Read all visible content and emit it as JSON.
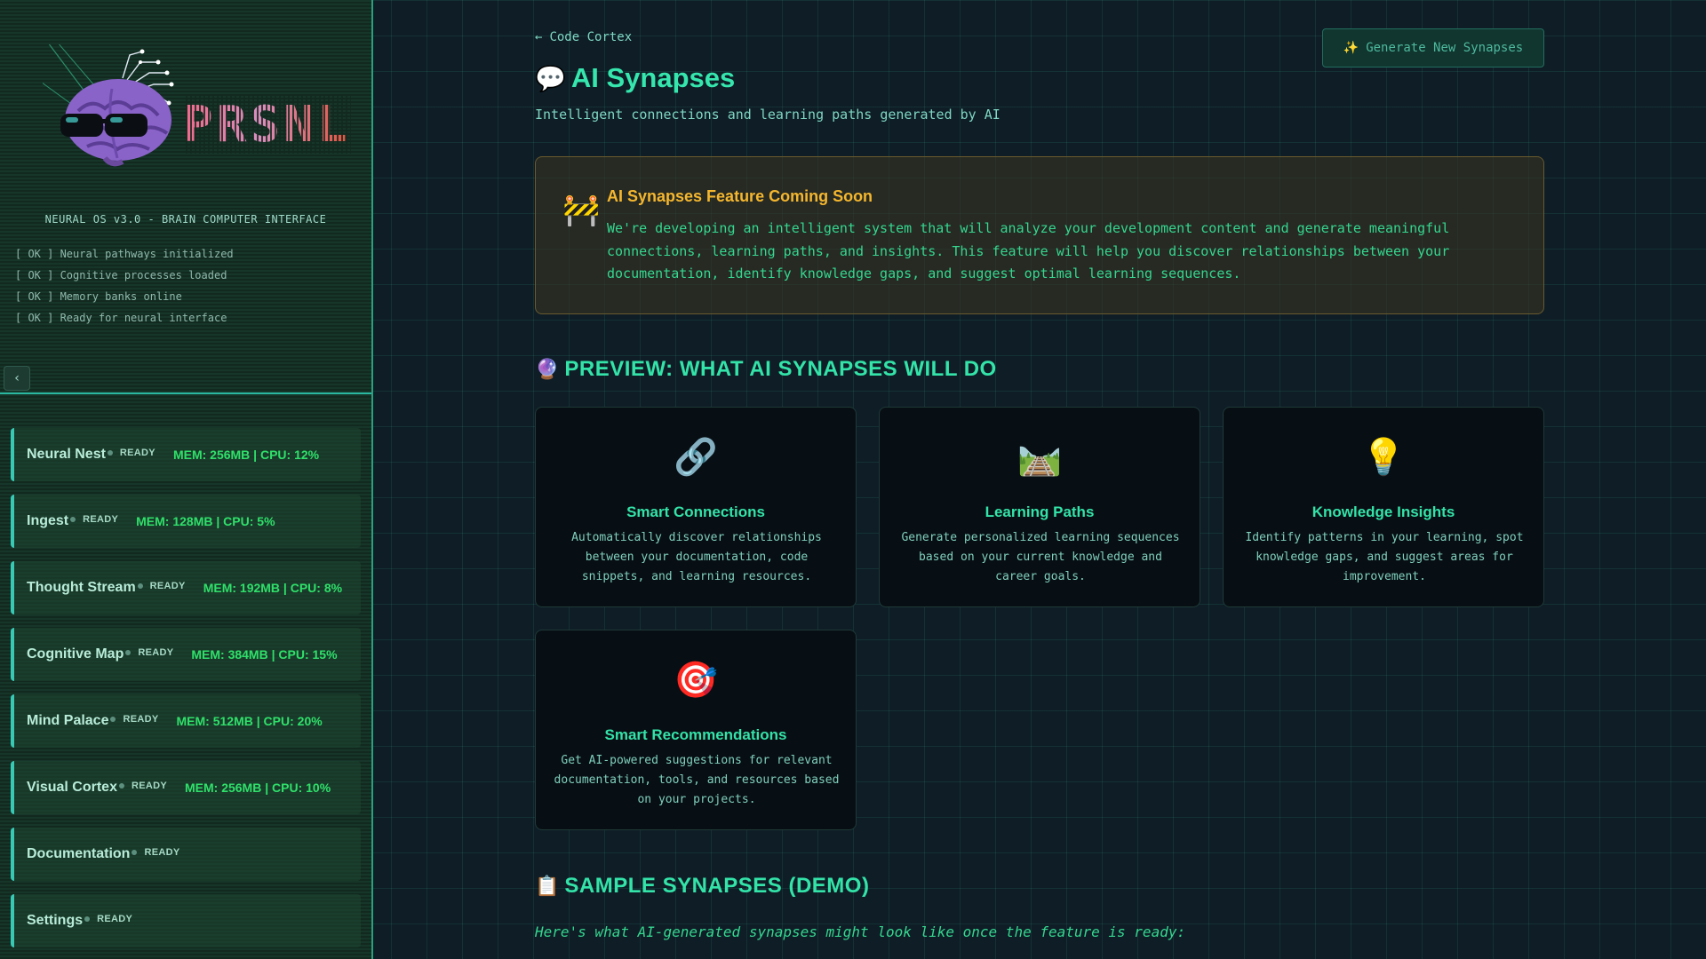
{
  "sidebar": {
    "logo_text": "PRSNL",
    "system_title": "NEURAL OS v3.0 - BRAIN COMPUTER INTERFACE",
    "boot_log": [
      "[ OK ] Neural pathways initialized",
      "[ OK ] Cognitive processes loaded",
      "[ OK ] Memory banks online",
      "[ OK ] Ready for neural interface"
    ],
    "collapse_icon": "chevron-left-icon",
    "collapse_glyph": "‹",
    "nav_items": [
      {
        "label": "Neural Nest",
        "status": "READY",
        "stats": "MEM: 256MB | CPU: 12%"
      },
      {
        "label": "Ingest",
        "status": "READY",
        "stats": "MEM: 128MB | CPU: 5%"
      },
      {
        "label": "Thought Stream",
        "status": "READY",
        "stats": "MEM: 192MB | CPU: 8%"
      },
      {
        "label": "Cognitive Map",
        "status": "READY",
        "stats": "MEM: 384MB | CPU: 15%"
      },
      {
        "label": "Mind Palace",
        "status": "READY",
        "stats": "MEM: 512MB | CPU: 20%"
      },
      {
        "label": "Visual Cortex",
        "status": "READY",
        "stats": "MEM: 256MB | CPU: 10%"
      },
      {
        "label": "Documentation",
        "status": "READY",
        "stats": ""
      },
      {
        "label": "Settings",
        "status": "READY",
        "stats": ""
      }
    ]
  },
  "header": {
    "back_arrow": "←",
    "back_label": "Code Cortex",
    "generate_icon": "sparkles-icon",
    "generate_glyph": "✨",
    "generate_label": "Generate New Synapses",
    "title_emoji": "💬",
    "title": "AI Synapses",
    "subtitle": "Intelligent connections and learning paths generated by AI"
  },
  "notice": {
    "emoji": "🚧",
    "title": "AI Synapses Feature Coming Soon",
    "body": "We're developing an intelligent system that will analyze your development content and generate meaningful connections, learning paths, and insights. This feature will help you discover relationships between your documentation, identify knowledge gaps, and suggest optimal learning sequences."
  },
  "preview": {
    "emoji": "🔮",
    "heading": "PREVIEW: WHAT AI SYNAPSES WILL DO",
    "cards": [
      {
        "emoji": "🔗",
        "title": "Smart Connections",
        "desc": "Automatically discover relationships between your documentation, code snippets, and learning resources."
      },
      {
        "emoji": "🛤️",
        "title": "Learning Paths",
        "desc": "Generate personalized learning sequences based on your current knowledge and career goals."
      },
      {
        "emoji": "💡",
        "title": "Knowledge Insights",
        "desc": "Identify patterns in your learning, spot knowledge gaps, and suggest areas for improvement."
      },
      {
        "emoji": "🎯",
        "title": "Smart Recommendations",
        "desc": "Get AI-powered suggestions for relevant documentation, tools, and resources based on your projects."
      }
    ]
  },
  "samples": {
    "emoji": "📋",
    "heading": "SAMPLE SYNAPSES (DEMO)",
    "intro": "Here's what AI-generated synapses might look like once the feature is ready:"
  },
  "colors": {
    "accent": "#33e3a8",
    "warning": "#f5b62e",
    "ready_stats": "#2fe06a",
    "background": "#0e1d26"
  }
}
